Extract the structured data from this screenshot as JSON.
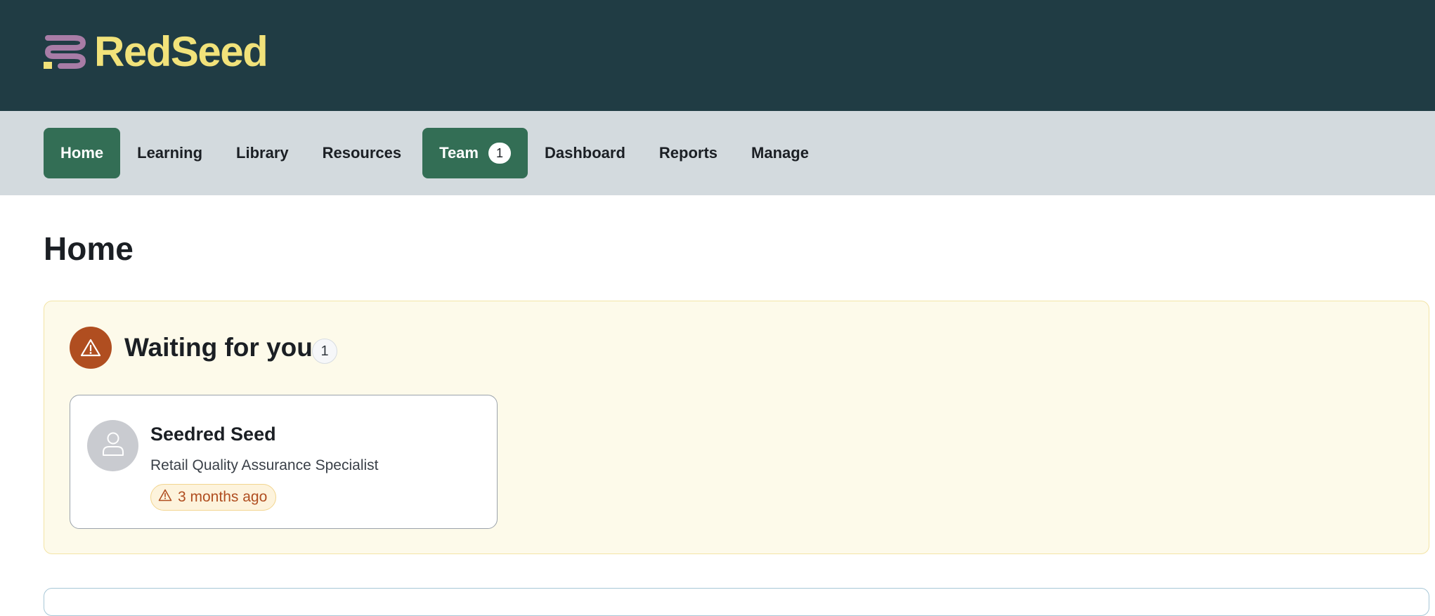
{
  "brand": {
    "name": "RedSeed",
    "logo_icon": "redseed-logo-icon",
    "text_color": "#f1e27a",
    "header_bg": "#203c44"
  },
  "nav": {
    "items": [
      {
        "label": "Home",
        "active": true
      },
      {
        "label": "Learning"
      },
      {
        "label": "Library"
      },
      {
        "label": "Resources"
      },
      {
        "label": "Team",
        "badge": "1",
        "active": true
      },
      {
        "label": "Dashboard"
      },
      {
        "label": "Reports"
      },
      {
        "label": "Manage"
      }
    ],
    "active_color": "#336e55"
  },
  "page": {
    "title": "Home"
  },
  "waiting": {
    "title": "Waiting for you",
    "count": "1",
    "icon": "warning-icon",
    "cards": [
      {
        "name": "Seedred Seed",
        "role": "Retail Quality Assurance Specialist",
        "time": "3 months ago",
        "avatar_icon": "user-icon",
        "time_icon": "warning-icon"
      }
    ]
  }
}
